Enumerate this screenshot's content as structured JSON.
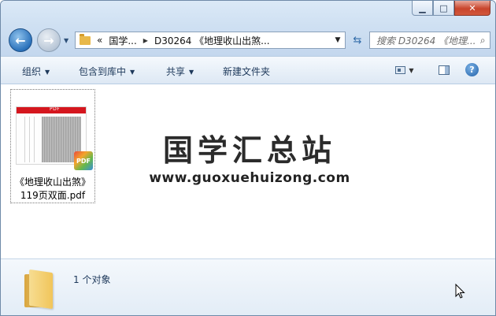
{
  "window": {
    "minimize_glyph": "▁",
    "maximize_glyph": "□",
    "close_glyph": "✕"
  },
  "navigation": {
    "back_glyph": "←",
    "forward_glyph": "→",
    "address": {
      "overflow": "«",
      "crumbs": [
        "国学...",
        "D30264 《地理收山出煞..."
      ]
    },
    "search_placeholder": "搜索 D30264 《地理..."
  },
  "toolbar": {
    "organize": "组织",
    "include_in_library": "包含到库中",
    "share": "共享",
    "new_folder": "新建文件夹"
  },
  "file": {
    "name_line1": "《地理收山出煞》",
    "name_line2": "119页双面.pdf",
    "thumb_label": "PDF",
    "badge_label": "PDF"
  },
  "watermark": {
    "title": "国学汇总站",
    "url": "www.guoxuehuizong.com"
  },
  "details": {
    "item_count": "1 个对象"
  },
  "icons": {
    "back": "arrow-left-icon",
    "forward": "arrow-right-icon",
    "folder": "folder-icon",
    "refresh": "refresh-icon",
    "search": "search-icon",
    "help": "help-icon",
    "pdf": "pdf-icon",
    "cursor": "mouse-cursor-icon"
  }
}
